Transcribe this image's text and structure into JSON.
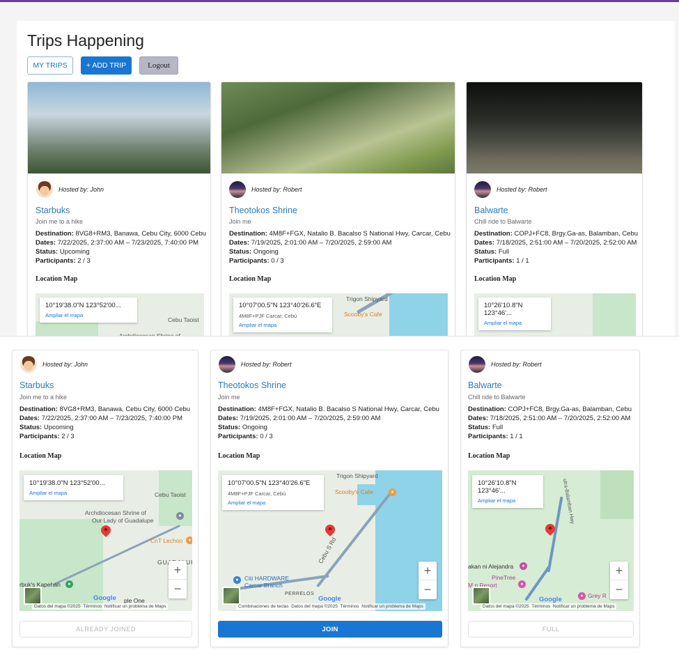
{
  "page": {
    "title": "Trips Happening",
    "buttons": {
      "my_trips": "MY TRIPS",
      "add_trip": "+ ADD TRIP",
      "logout": "Logout"
    }
  },
  "colors": {
    "accent": "#1976d2",
    "link": "#2b7bb9",
    "topbar": "#6a3d9a"
  },
  "labels": {
    "destination": "Destination:",
    "dates": "Dates:",
    "status": "Status:",
    "participants": "Participants:",
    "location_map": "Location Map",
    "hosted_by": "Hosted by:",
    "map_enlarge": "Ampliar el mapa"
  },
  "trips": [
    {
      "host": "John",
      "host_label": "Hosted by: John",
      "avatar": "boy-avatar-icon",
      "title": "Starbuks",
      "description": "Join me to a hike",
      "destination": "8VG8+RM3, Banawa, Cebu City, 6000 Cebu",
      "dates": "7/22/2025, 2:37:00 AM – 7/23/2025, 7:40:00 PM",
      "status": "Upcoming",
      "participants": "2 / 3",
      "map_coord": "10°19'38.0\"N 123°52'00...",
      "map_subtext": "",
      "action": "ALREADY JOINED",
      "action_enabled": false
    },
    {
      "host": "Robert",
      "host_label": "Hosted by: Robert",
      "avatar": "sunset-avatar-icon",
      "title": "Theotokos Shrine",
      "description": "Join me",
      "destination": "4M8F+FGX, Natalio B. Bacalso S National Hwy, Carcar, Cebu",
      "dates": "7/19/2025, 2:01:00 AM – 7/20/2025, 2:59:00 AM",
      "status": "Ongoing",
      "participants": "0 / 3",
      "map_coord": "10°07'00.5\"N 123°40'26.6\"E",
      "map_subtext": "4M8F+PJF Carcar, Cebú",
      "action": "JOIN",
      "action_enabled": true
    },
    {
      "host": "Robert",
      "host_label": "Hosted by: Robert",
      "avatar": "sunset-avatar-icon",
      "title": "Balwarte",
      "description": "Chill ride to Balwarte",
      "destination": "COPJ+FC8, Brgy.Ga-as, Balamban, Cebu",
      "dates": "7/18/2025, 2:51:00 AM – 7/20/2025, 2:52:00 AM",
      "status": "Full",
      "participants": "1 / 1",
      "map_coord": "10°26'10.8\"N 123°46'...",
      "map_subtext": "",
      "action": "FULL",
      "action_enabled": false
    }
  ],
  "map_poi": {
    "cebu_taoist": "Cebu Taoist",
    "archdiocesan_1": "Archdiocesan Shrine of",
    "archdiocesan_2": "Our Lady of Guadalupe",
    "cnt_lechon": "CnT Lechon",
    "guadalupe": "GUADALUP",
    "kapehan": "rbuk's Kapehan",
    "apple_one": "ple One",
    "trigon": "Trigon Shipyard",
    "scoobys": "Scooby's Cafe",
    "citi_hardware_1": "Citi HARDWARE",
    "citi_hardware_2": "Carcar Branch",
    "perrelos": "PERRELOS",
    "cebu_s_rd": "Cebu S Rd",
    "alejandra": "akan ni Alejandra",
    "pinetree_1": "PineTree",
    "pinetree_2": "M     n Resort",
    "grey_r": "Grey R",
    "hwy": "utra-Balamban Hwy"
  },
  "map_footer": {
    "data_1": "Datos del mapa ©2025",
    "terms": "Términos",
    "report": "Notificar un problema de Maps",
    "shortcuts": "Combinaciones de teclas",
    "google": "Google"
  }
}
